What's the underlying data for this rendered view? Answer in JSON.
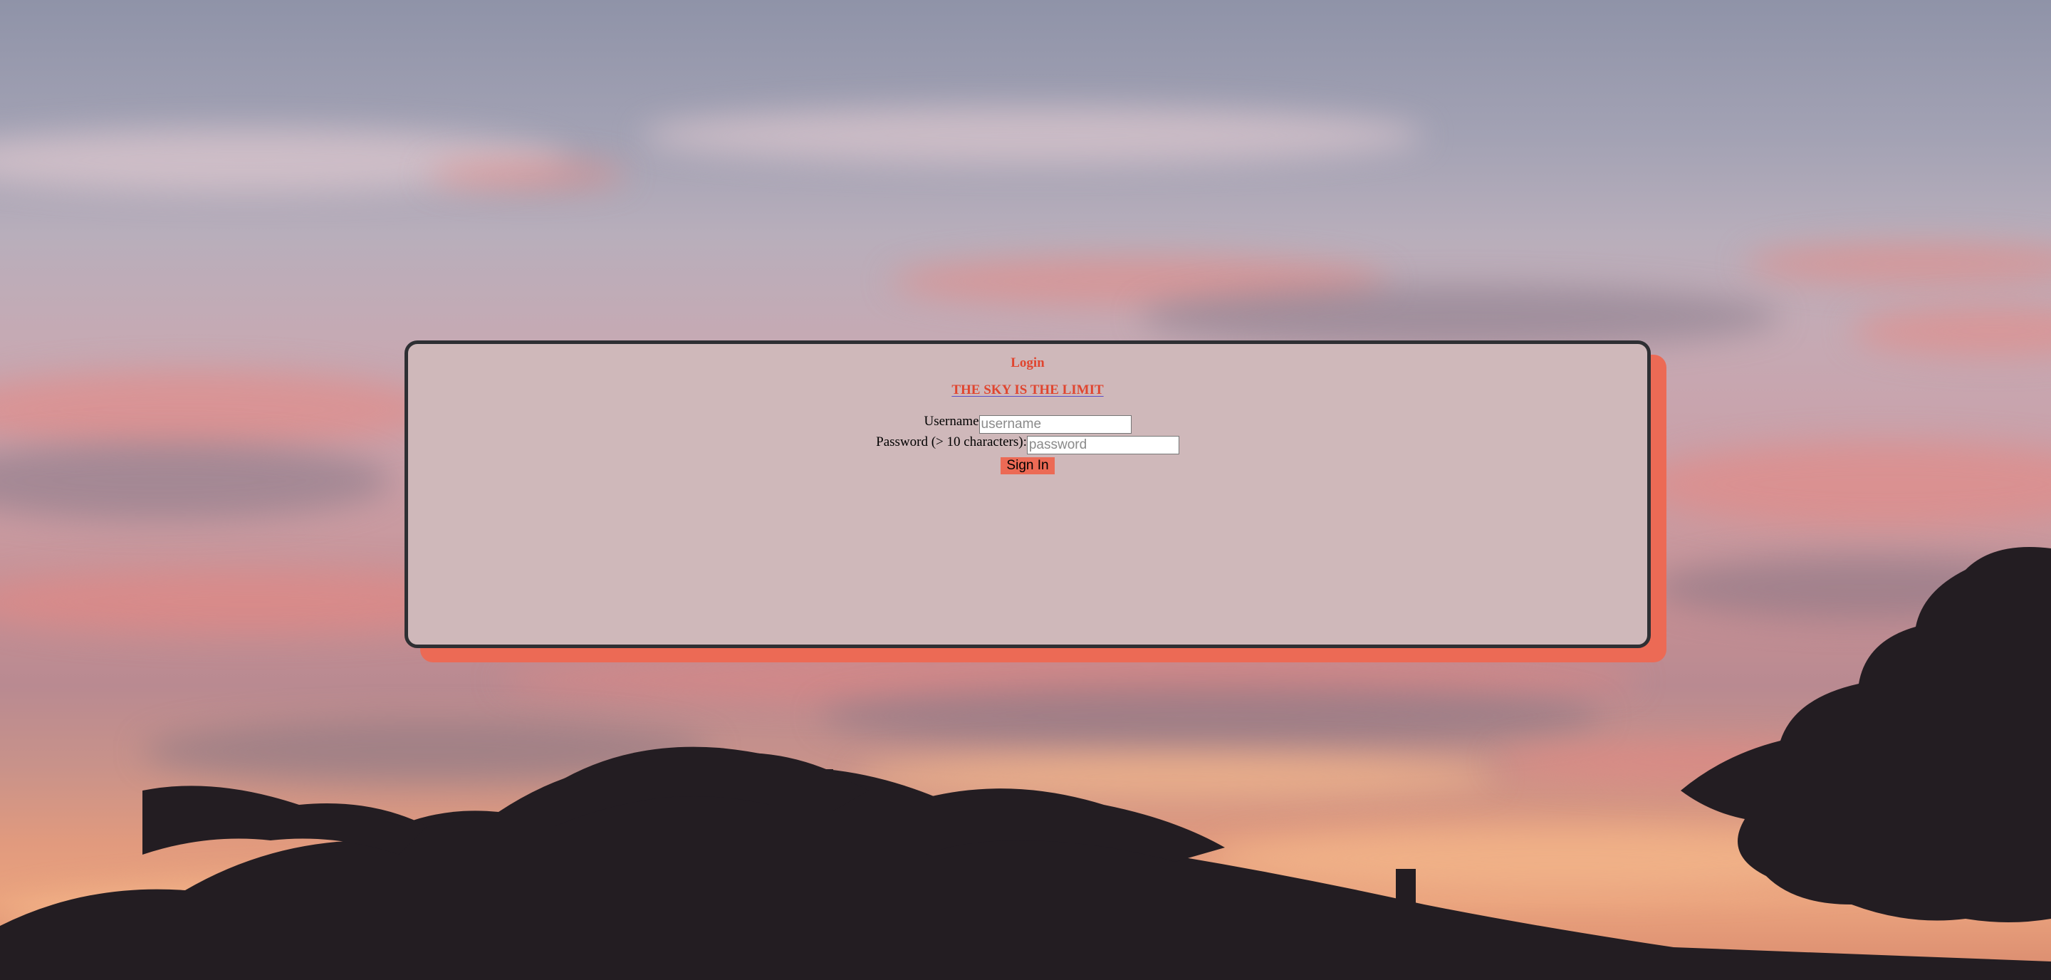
{
  "background": {
    "description_colors": {
      "sky_top": "#8f93a8",
      "cloud_pink": "#e88682",
      "horizon_glow": "#eaa37e",
      "accent": "#ec6a55"
    }
  },
  "login": {
    "title": "Login",
    "tagline": "THE SKY IS THE LIMIT",
    "username_label": "Username",
    "username_placeholder": "username",
    "username_value": "",
    "password_label": "Password (> 10 characters):",
    "password_placeholder": "password",
    "password_value": "",
    "signin_label": "Sign In"
  },
  "colors": {
    "panel_bg": "#cfb8ba",
    "panel_border": "#2e2f33",
    "panel_shadow": "#ec6a55",
    "heading": "#e0452f",
    "button_bg": "#ec6a55"
  }
}
